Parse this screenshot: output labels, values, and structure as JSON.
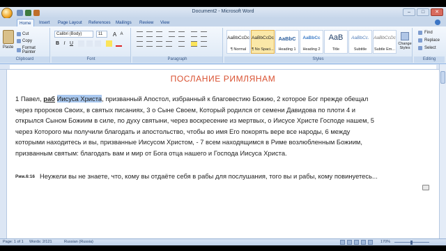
{
  "window": {
    "title": "Document2 - Microsoft Word",
    "minimize": "–",
    "maximize": "□",
    "close": "✕"
  },
  "tabs": [
    "Home",
    "Insert",
    "Page Layout",
    "References",
    "Mailings",
    "Review",
    "View"
  ],
  "ribbon": {
    "clipboard": {
      "paste": "Paste",
      "cut": "Cut",
      "copy": "Copy",
      "format_painter": "Format Painter",
      "label": "Clipboard"
    },
    "font": {
      "name": "Calibri (Body)",
      "size": "11",
      "label": "Font",
      "bold": "B",
      "italic": "I",
      "underline": "U",
      "grow": "A",
      "shrink": "A"
    },
    "paragraph": {
      "label": "Paragraph"
    },
    "styles": {
      "items": [
        {
          "sample": "AaBbCcDc",
          "name": "¶ Normal"
        },
        {
          "sample": "AaBbCcDc",
          "name": "¶ No Spaci..."
        },
        {
          "sample": "AaBbC",
          "name": "Heading 1"
        },
        {
          "sample": "AaBbCc",
          "name": "Heading 2"
        },
        {
          "sample": "AaB",
          "name": "Title"
        },
        {
          "sample": "AaBbCc.",
          "name": "Subtitle"
        },
        {
          "sample": "AaBbCcDc",
          "name": "Subtle Em..."
        }
      ],
      "label": "Styles",
      "change_styles": "Change Styles"
    },
    "editing": {
      "find": "Find",
      "replace": "Replace",
      "select": "Select",
      "label": "Editing"
    }
  },
  "document": {
    "title": "ПОСЛАНИЕ  РИМЛЯНАМ",
    "para_lines": {
      "l1_pre": "1 Павел, ",
      "l1_bold": "раб",
      "l1_mid": " ",
      "l1_hl": "Иисуса Христа",
      "l1_post": ", призванный Апостол, избранный к благовестию Божию, 2 которое Бог прежде обещал",
      "l2": "через пророков Своих, в святых писаниях, 3 о Сыне Своем, Который родился от семени Давидова по плоти 4 и",
      "l3": "открылся Сыном Божиим в силе, по духу святыни, через воскресение из мертвых, о Иисусе Христе Господе нашем, 5",
      "l4": "через Которого мы получили благодать и апостольство, чтобы во имя Его покорять вере все народы, 6 между",
      "l5": "которыми находитесь и вы, призванные Иисусом Христом, - 7 всем находящимся в Риме возлюбленным Божиим,",
      "l6": "призванным святым: благодать вам и мир от Бога отца нашего и Господа Иисуса Христа."
    },
    "verse_ref": "Рим.6:16",
    "verse_text": "Неужели вы не знаете, что, кому вы отдаёте себя в рабы для послушания, того вы и рабы, кому повинуетесь..."
  },
  "statusbar": {
    "page": "Page: 1 of 1",
    "words": "Words: 2/121",
    "language": "Russian (Russia)",
    "zoom": "170%"
  },
  "colors": {
    "title_red": "#d95030",
    "selection": "#a9c8ef",
    "ribbon_blue": "#dbe7f5"
  }
}
